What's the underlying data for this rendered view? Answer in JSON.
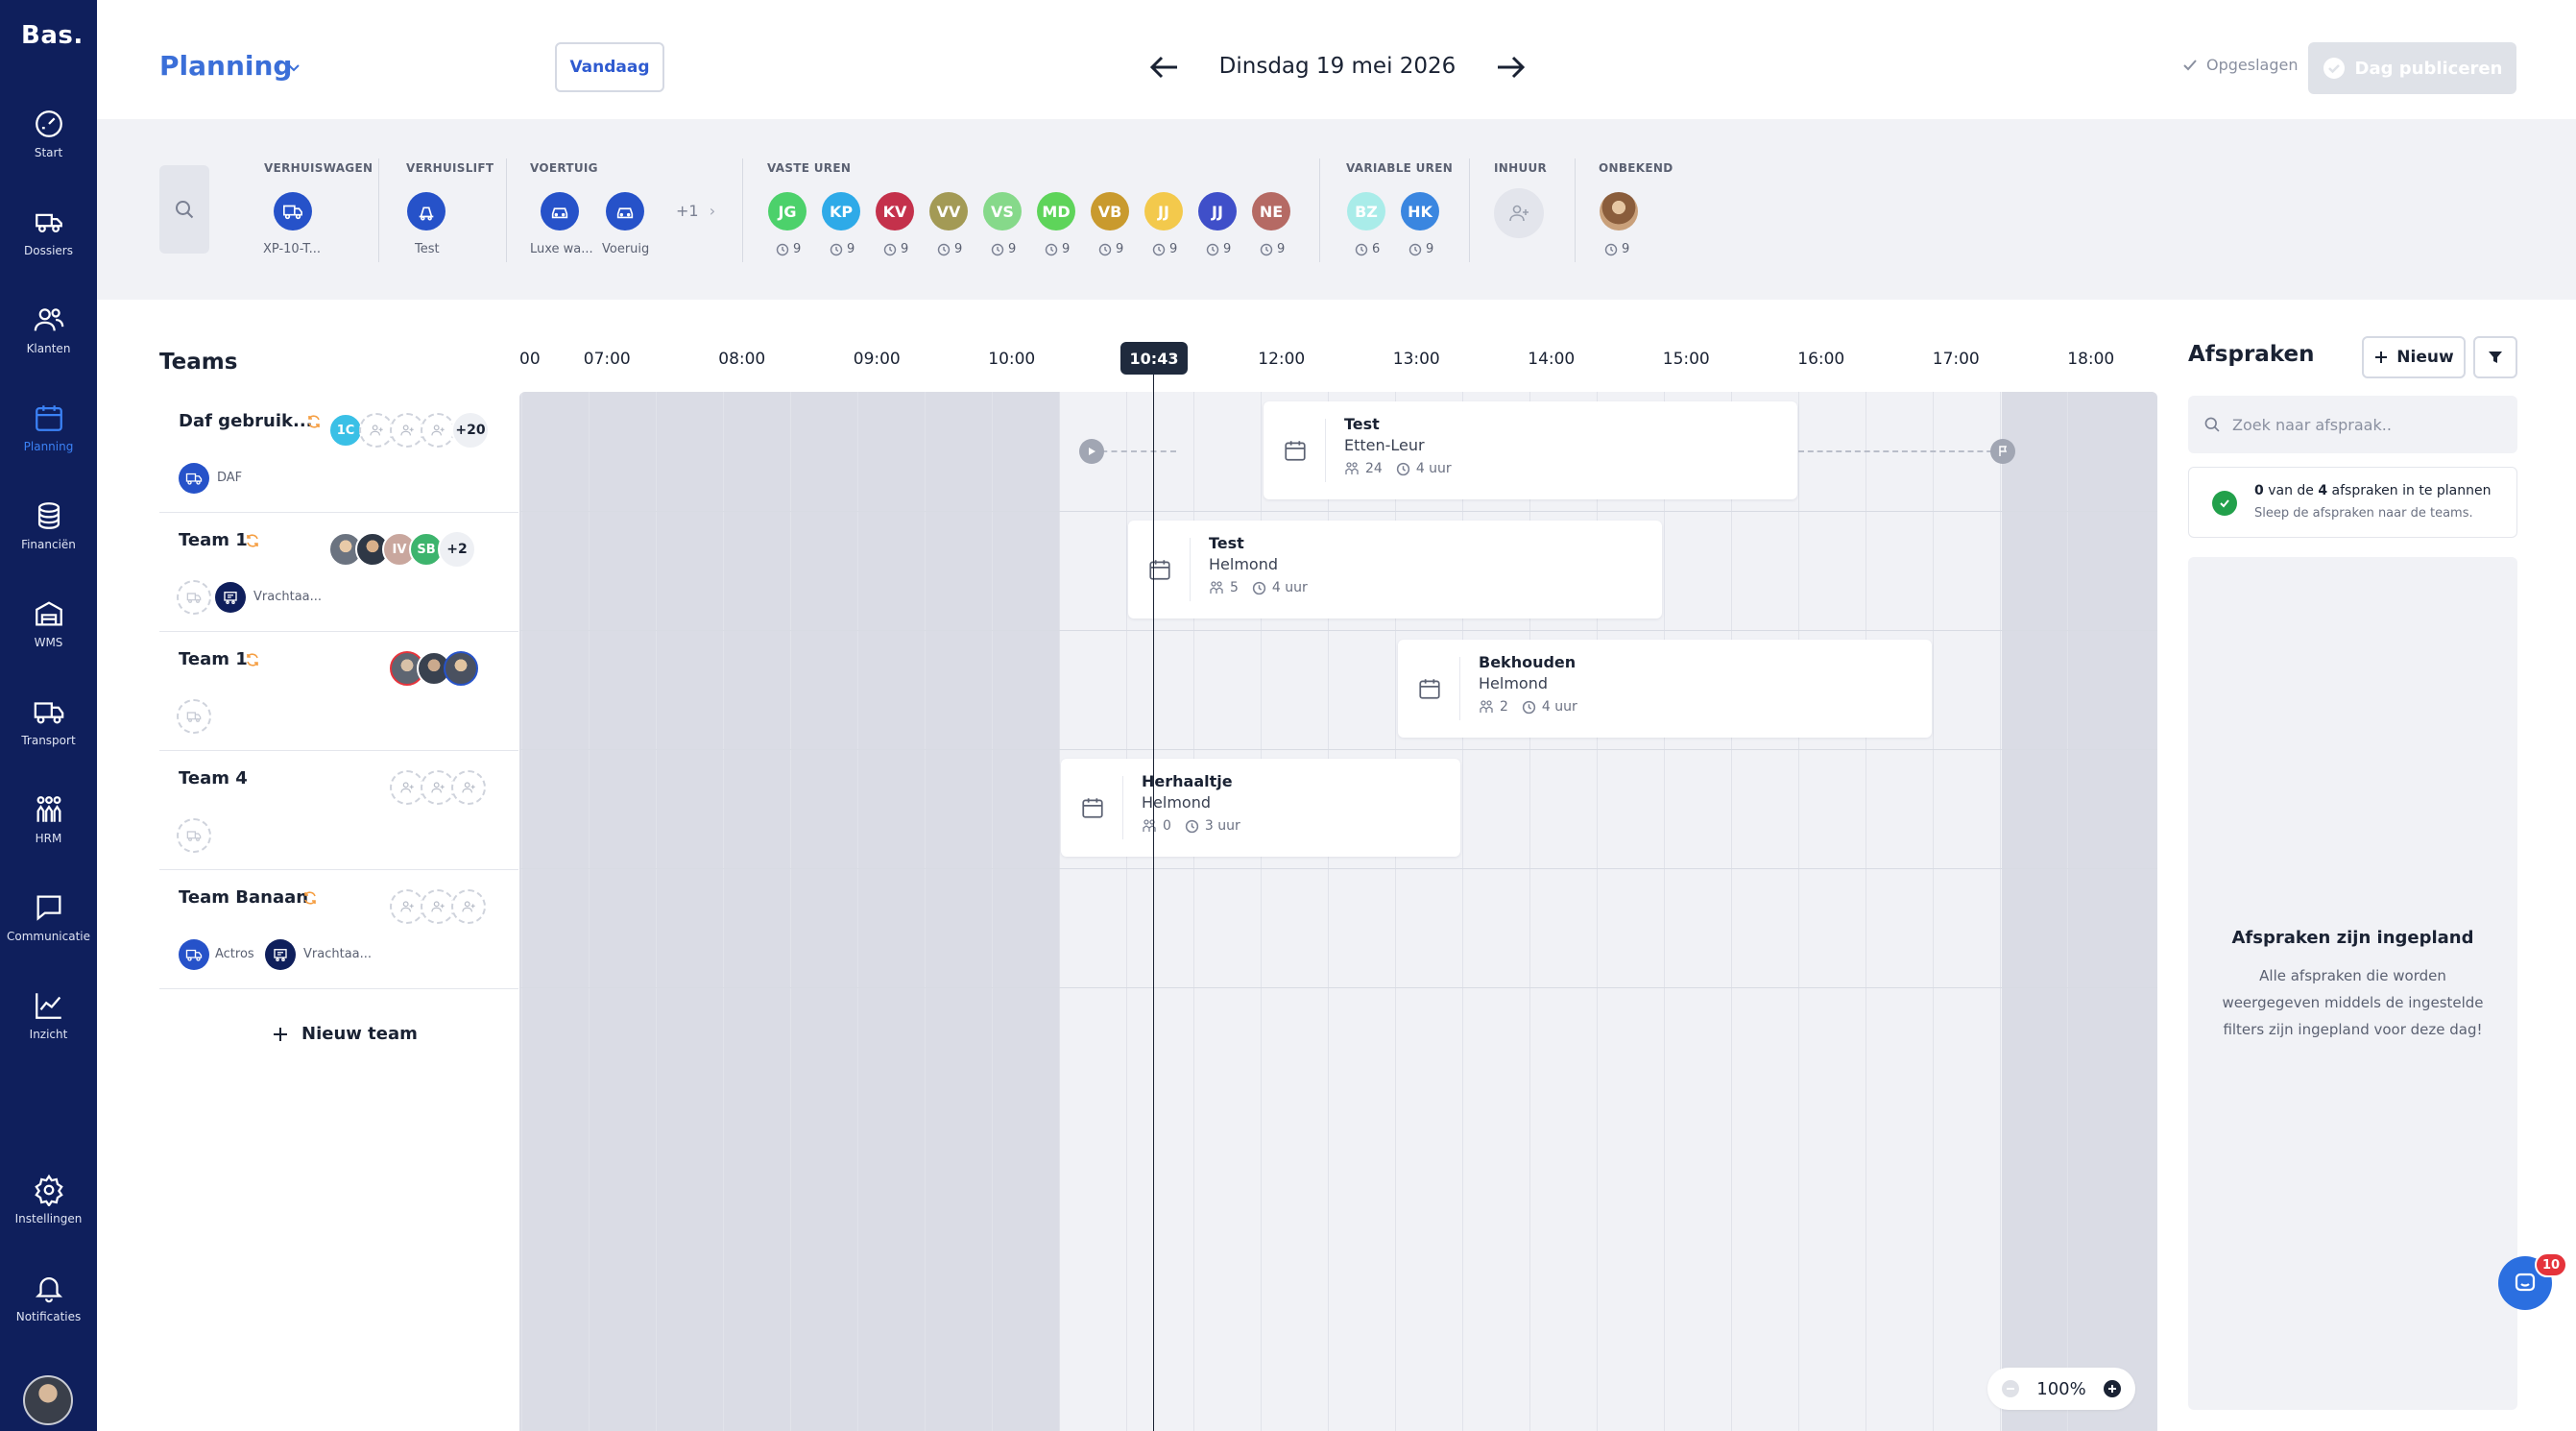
{
  "app": {
    "logo": "Bas."
  },
  "sidebar": {
    "items": [
      {
        "label": "Start",
        "icon": "dashboard-icon"
      },
      {
        "label": "Dossiers",
        "icon": "truck-box-icon"
      },
      {
        "label": "Klanten",
        "icon": "users-icon"
      },
      {
        "label": "Planning",
        "icon": "calendar-icon",
        "active": true
      },
      {
        "label": "Financiën",
        "icon": "coins-icon"
      },
      {
        "label": "WMS",
        "icon": "warehouse-icon"
      },
      {
        "label": "Transport",
        "icon": "truck-icon"
      },
      {
        "label": "HRM",
        "icon": "team-icon"
      },
      {
        "label": "Communicatie",
        "icon": "chat-icon"
      },
      {
        "label": "Inzicht",
        "icon": "chart-icon"
      },
      {
        "label": "Instellingen",
        "icon": "gear-icon"
      },
      {
        "label": "Notificaties",
        "icon": "bell-icon"
      }
    ]
  },
  "header": {
    "title": "Planning",
    "today_label": "Vandaag",
    "date_label": "Dinsdag 19 mei 2026",
    "saved_label": "Opgeslagen",
    "publish_label": "Dag publiceren"
  },
  "resources": {
    "groups": {
      "verhuiswagen": "VERHUISWAGEN",
      "verhuislift": "VERHUISLIFT",
      "voertuig": "VOERTUIG",
      "vaste_uren": "VASTE UREN",
      "variable_uren": "VARIABLE UREN",
      "inhuur": "INHUUR",
      "onbekend": "ONBEKEND"
    },
    "vehicles": [
      {
        "label": "XP-10-T..."
      },
      {
        "label": "Test"
      },
      {
        "label": "Luxe wa..."
      },
      {
        "label": "Voeruig"
      }
    ],
    "vehicle_more": "+1",
    "fixed_employees": [
      {
        "initials": "JG",
        "hours": "9",
        "color": "#4cd16b"
      },
      {
        "initials": "KP",
        "hours": "9",
        "color": "#2eaae8"
      },
      {
        "initials": "KV",
        "hours": "9",
        "color": "#c4314b"
      },
      {
        "initials": "VV",
        "hours": "9",
        "color": "#a39a55"
      },
      {
        "initials": "VS",
        "hours": "9",
        "color": "#86d98a"
      },
      {
        "initials": "MD",
        "hours": "9",
        "color": "#5ed45a"
      },
      {
        "initials": "VB",
        "hours": "9",
        "color": "#c99a2e"
      },
      {
        "initials": "JJ",
        "hours": "9",
        "color": "#f3c94c"
      },
      {
        "initials": "JJ",
        "hours": "9",
        "color": "#3f4fc9"
      },
      {
        "initials": "NE",
        "hours": "9",
        "color": "#b56a64"
      }
    ],
    "variable_employees": [
      {
        "initials": "BZ",
        "hours": "6",
        "color": "#a9ece9"
      },
      {
        "initials": "HK",
        "hours": "9",
        "color": "#3a86e0"
      }
    ],
    "unknown_hours": "9"
  },
  "teams": {
    "heading": "Teams",
    "rows": [
      {
        "name": "Daf gebruik...",
        "member_initials": "1C",
        "member_color": "#3ac0e6",
        "more": "+20",
        "vehicles": [
          {
            "label": "DAF"
          }
        ]
      },
      {
        "name": "Team 1",
        "members": [
          {
            "initials": "IV",
            "color": "#c9a79e"
          },
          {
            "initials": "SB",
            "color": "#3db46d"
          }
        ],
        "more": "+2",
        "vehicles": [
          {
            "label": "Vrachtaa..."
          }
        ]
      },
      {
        "name": "Team 1",
        "vehicles": []
      },
      {
        "name": "Team 4",
        "vehicles": []
      },
      {
        "name": "Team Banaan",
        "vehicles": [
          {
            "label": "Actros"
          },
          {
            "label": "Vrachtaa..."
          }
        ]
      }
    ],
    "new_team_label": "Nieuw team"
  },
  "timeline": {
    "hours": [
      "00",
      "07:00",
      "08:00",
      "09:00",
      "10:00",
      "11:00",
      "12:00",
      "13:00",
      "14:00",
      "15:00",
      "16:00",
      "17:00",
      "18:00"
    ],
    "now_label": "10:43",
    "zoom_label": "100%",
    "appointments": [
      {
        "title": "Test",
        "location": "Etten-Leur",
        "people": "24",
        "duration": "4 uur"
      },
      {
        "title": "Test",
        "location": "Helmond",
        "people": "5",
        "duration": "4 uur"
      },
      {
        "title": "Bekhouden",
        "location": "Helmond",
        "people": "2",
        "duration": "4 uur"
      },
      {
        "title": "Herhaaltje",
        "location": "Helmond",
        "people": "0",
        "duration": "3 uur"
      }
    ]
  },
  "appointments_panel": {
    "heading": "Afspraken",
    "new_label": "Nieuw",
    "search_placeholder": "Zoek naar afspraak..",
    "status_count": "0",
    "status_mid": "van de",
    "status_total": "4",
    "status_rest": "afspraken in te plannen",
    "status_sub": "Sleep de afspraken naar de teams.",
    "empty_title": "Afspraken zijn ingepland",
    "empty_desc": "Alle afspraken die worden weergegeven middels de ingestelde filters zijn ingepland voor deze dag!"
  },
  "chat": {
    "badge": "10"
  },
  "colors": {
    "sidebar": "#0f1f5c",
    "accent": "#3b6fd8",
    "vehicle": "#2652c9"
  }
}
